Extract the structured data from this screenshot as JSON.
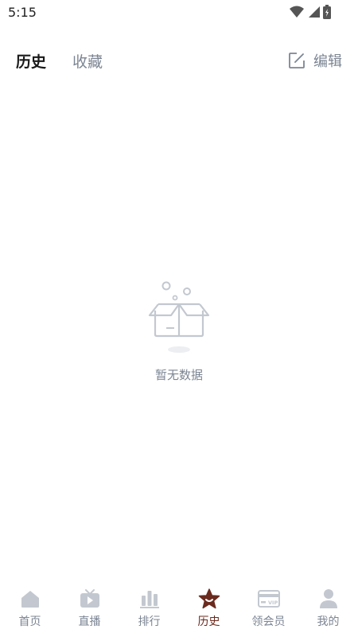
{
  "status_bar": {
    "time": "5:15"
  },
  "header": {
    "tabs": [
      {
        "label": "历史",
        "active": true
      },
      {
        "label": "收藏",
        "active": false
      }
    ],
    "edit_label": "编辑"
  },
  "empty_state": {
    "message": "暂无数据"
  },
  "bottom_nav": {
    "items": [
      {
        "label": "首页",
        "icon": "home-icon"
      },
      {
        "label": "直播",
        "icon": "tv-icon"
      },
      {
        "label": "排行",
        "icon": "ranking-icon"
      },
      {
        "label": "历史",
        "icon": "star-icon",
        "active": true
      },
      {
        "label": "领会员",
        "icon": "vip-card-icon"
      },
      {
        "label": "我的",
        "icon": "user-icon"
      }
    ]
  },
  "colors": {
    "accent": "#6b2a1e",
    "muted": "#7c8593",
    "icon_gray": "#c3c8d0"
  }
}
